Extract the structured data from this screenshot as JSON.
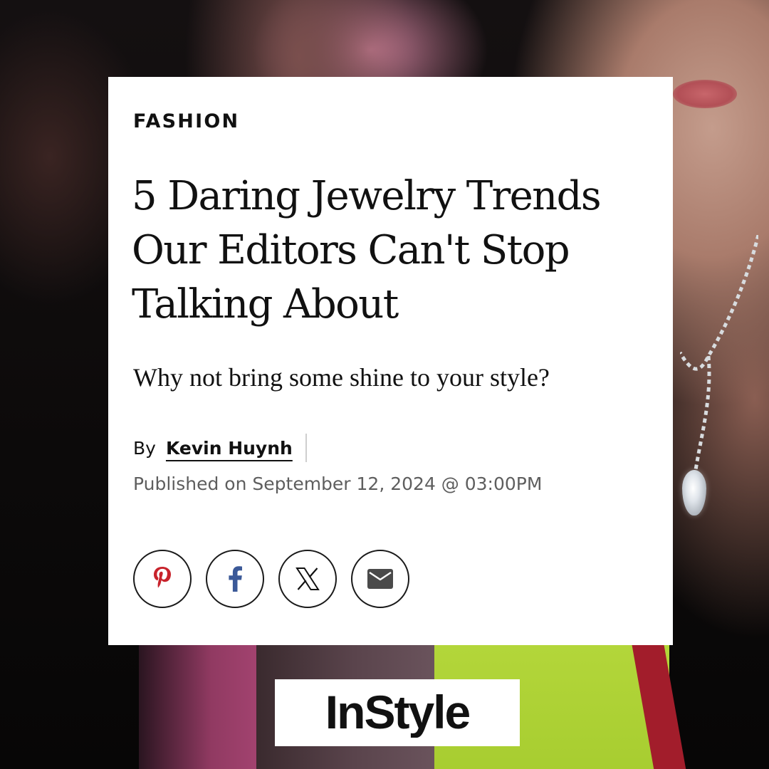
{
  "article": {
    "category": "FASHION",
    "headline": "5 Daring Jewelry Trends Our Editors Can't Stop Talking About",
    "deck": "Why not bring some shine to your style?",
    "byline_prefix": "By",
    "author": "Kevin Huynh",
    "published": "Published on September 12, 2024 @ 03:00PM"
  },
  "share": {
    "buttons": [
      {
        "name": "pinterest",
        "icon": "pinterest-icon"
      },
      {
        "name": "facebook",
        "icon": "facebook-icon"
      },
      {
        "name": "x",
        "icon": "x-icon"
      },
      {
        "name": "email",
        "icon": "email-icon"
      }
    ]
  },
  "brand": {
    "logo_text": "InStyle"
  },
  "colors": {
    "pinterest": "#c8232c",
    "facebook": "#3b5998",
    "x": "#111111",
    "email": "#4a4a4a",
    "dress_green": "#a6cc2f"
  }
}
